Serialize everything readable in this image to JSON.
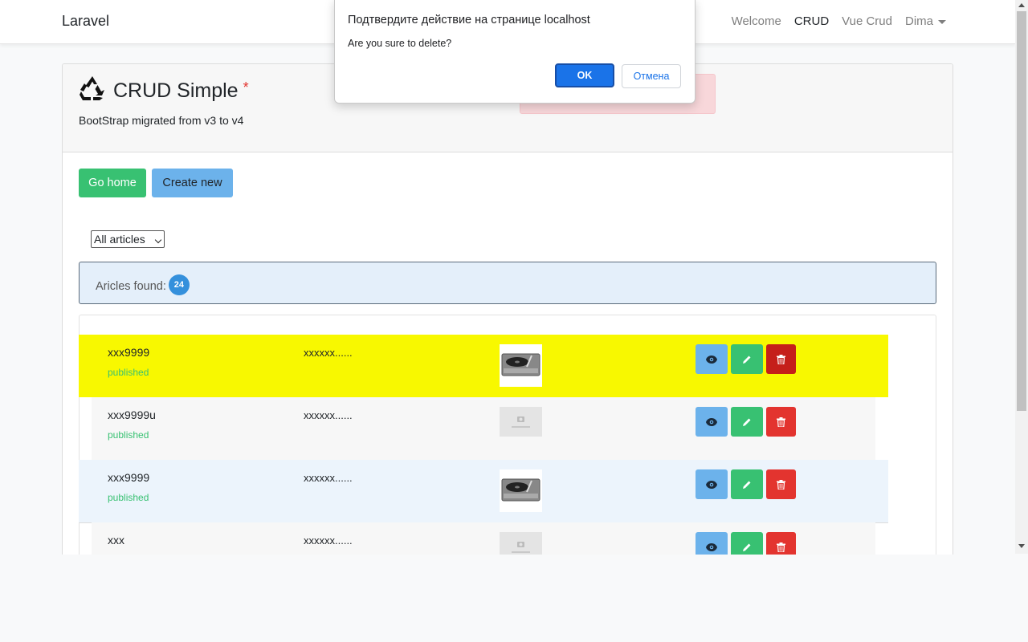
{
  "navbar": {
    "brand": "Laravel",
    "links": [
      {
        "label": "Welcome"
      },
      {
        "label": "CRUD"
      },
      {
        "label": "Vue Crud"
      },
      {
        "label": "Dima"
      }
    ]
  },
  "header": {
    "title": "CRUD Simple",
    "required_mark": "*",
    "subtitle": "BootStrap migrated from v3 to v4"
  },
  "buttons": {
    "home": "Go home",
    "create": "Create new"
  },
  "filter": {
    "selected": "All articles"
  },
  "info": {
    "label": "Aricles found:",
    "count": "24"
  },
  "articles": [
    {
      "name": "xxx9999",
      "status": "published",
      "excerpt": "xxxxxx......",
      "image": "turntable"
    },
    {
      "name": "xxx9999u",
      "status": "published",
      "excerpt": "xxxxxx......",
      "image": "no-image"
    },
    {
      "name": "xxx9999",
      "status": "published",
      "excerpt": "xxxxxx......",
      "image": "turntable"
    },
    {
      "name": "xxx",
      "status": "",
      "excerpt": "xxxxxx......",
      "image": "no-image"
    }
  ],
  "dialog": {
    "title": "Подтвердите действие на странице localhost",
    "message": "Are you sure to delete?",
    "ok": "OK",
    "cancel": "Отмена"
  },
  "colors": {
    "success": "#38c172",
    "info": "#6cb2eb",
    "danger": "#e3342f",
    "highlight": "#f8f800",
    "primary": "#1a73e8"
  }
}
